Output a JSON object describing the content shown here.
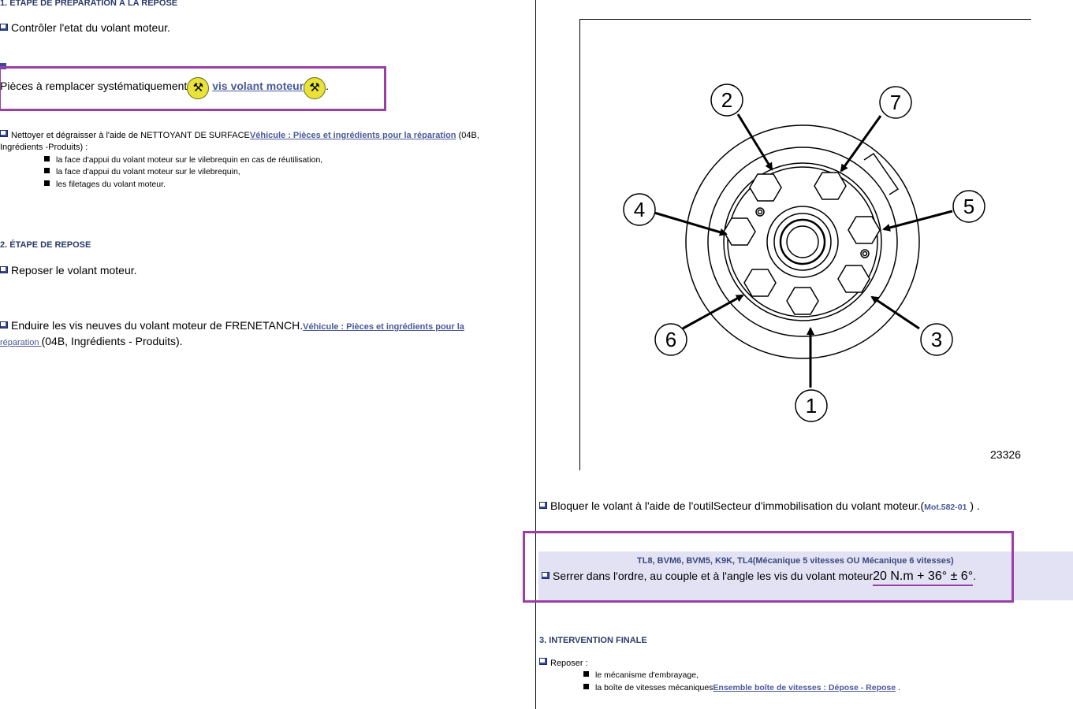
{
  "colors": {
    "highlight_border": "#9b3fa6",
    "link": "#4a5a9a",
    "heading": "#2a3a6a",
    "band": "#e2e2f4",
    "tool_icon": "#e8e23a"
  },
  "left": {
    "section1_title": "1. ÉTAPE DE PRÉPARATION À LA REPOSE",
    "check_flywheel": "Contrôler l'etat du volant moteur.",
    "parts_label": "Pièces à remplacer systématiquement",
    "parts_link": "vis volant moteur",
    "parts_end": ".",
    "tool_icon": "tool-icon",
    "clean_text": "Nettoyer et dégraisser à l'aide de NETTOYANT DE SURFACE",
    "clean_link": "Véhicule : Pièces et ingrédients pour la réparation",
    "clean_ref": " (04B,",
    "clean_ref2": "Ingrédients -Produits) :",
    "clean_items": [
      "la face d'appui du volant moteur sur le vilebrequin en cas de réutilisation,",
      "la face d'appui du volant moteur sur le vilebrequin,",
      "les filetages du volant moteur."
    ],
    "section2_title": "2. ÉTAPE DE REPOSE",
    "refit_flywheel": "Reposer le volant moteur.",
    "coat_text": "Enduire les vis neuves du volant moteur de FRENETANCH.",
    "coat_link_a": "Véhicule : Pièces et ingrédients pour la",
    "coat_link_b": "réparation ",
    "coat_ref": "(04B, Ingrédients - Produits)."
  },
  "figure": {
    "number": "23326",
    "bolt_labels": [
      "1",
      "2",
      "3",
      "4",
      "5",
      "6",
      "7"
    ]
  },
  "right": {
    "lock_text": "Bloquer le volant à l'aide de l'outilSecteur d'immobilisation du volant moteur.(",
    "lock_tool": "Mot.582-01",
    "lock_end": " ) .",
    "variants": "TL8, BVM6, BVM5, K9K, TL4(Mécanique 5 vitesses OU Mécanique 6 vitesses)",
    "tighten_text": "Serrer dans l'ordre, au couple et à l'angle les vis du volant moteur",
    "torque_value": "20 N.m + 36° ± 6°",
    "tighten_end": ".",
    "section3_title": "3. INTERVENTION FINALE",
    "refit_label": "Reposer :",
    "refit_items": [
      "le mécanisme d'embrayage,",
      "la boîte de vitesses mécaniques"
    ],
    "gearbox_link": "Ensemble boîte de vitesses : Dépose - Repose",
    "gearbox_end": " ."
  }
}
